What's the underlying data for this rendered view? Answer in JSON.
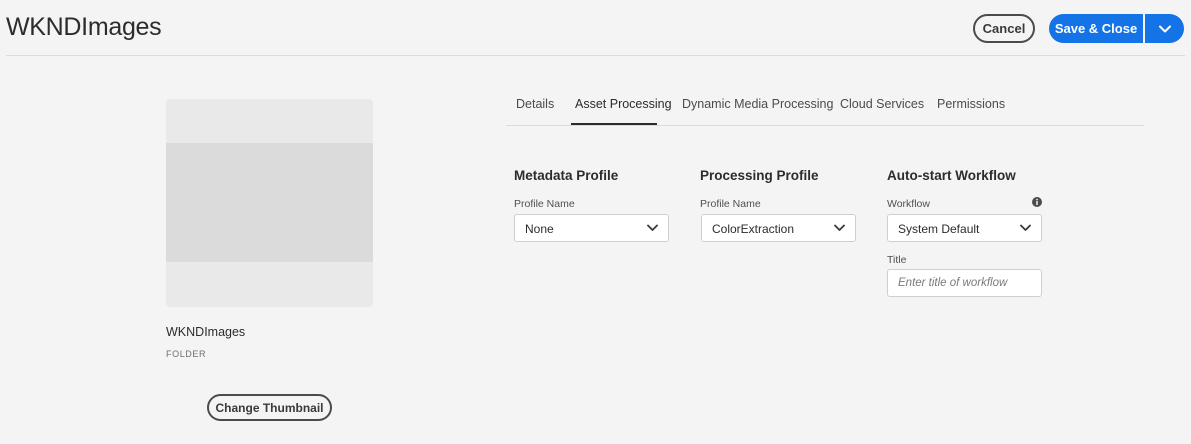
{
  "header": {
    "title": "WKNDImages",
    "cancel_label": "Cancel",
    "save_label": "Save & Close"
  },
  "folder": {
    "name": "WKNDImages",
    "type": "FOLDER",
    "change_thumbnail_label": "Change Thumbnail"
  },
  "tabs": [
    {
      "label": "Details"
    },
    {
      "label": "Asset Processing"
    },
    {
      "label": "Dynamic Media Processing"
    },
    {
      "label": "Cloud Services"
    },
    {
      "label": "Permissions"
    }
  ],
  "active_tab": "Asset Processing",
  "metadata_profile": {
    "heading": "Metadata Profile",
    "field_label": "Profile Name",
    "value": "None"
  },
  "processing_profile": {
    "heading": "Processing Profile",
    "field_label": "Profile Name",
    "value": "ColorExtraction"
  },
  "workflow": {
    "heading": "Auto-start Workflow",
    "field_label": "Workflow",
    "value": "System Default",
    "title_label": "Title",
    "title_value": "",
    "title_placeholder": "Enter title of workflow"
  },
  "colors": {
    "accent": "#1473e6",
    "background": "#f4f4f4"
  },
  "icons": [
    "chevron-down-icon",
    "info-icon"
  ]
}
